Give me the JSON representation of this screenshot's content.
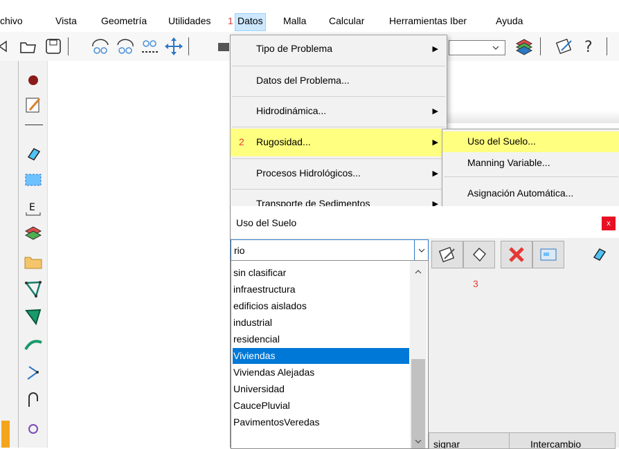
{
  "menubar": {
    "items": [
      {
        "label": "chivo"
      },
      {
        "label": "Vista"
      },
      {
        "label": "Geometría"
      },
      {
        "label": "Utilidades"
      },
      {
        "label": "Datos",
        "marker": "1"
      },
      {
        "label": "Malla"
      },
      {
        "label": "Calcular"
      },
      {
        "label": "Herramientas Iber"
      },
      {
        "label": "Ayuda"
      }
    ]
  },
  "datos_menu": {
    "items": [
      {
        "label": "Tipo de Problema",
        "submenu": true
      },
      {
        "label": "Datos del Problema...",
        "submenu": false
      },
      {
        "label": "Hidrodinámica...",
        "submenu": true
      },
      {
        "label": "Rugosidad...",
        "submenu": true,
        "marker": "2"
      },
      {
        "label": "Procesos Hidrológicos...",
        "submenu": true
      },
      {
        "label": "Transporte de Sedimentos",
        "submenu": true
      }
    ]
  },
  "rugosidad_submenu": {
    "items": [
      {
        "label": "Uso del Suelo..."
      },
      {
        "label": "Manning Variable..."
      },
      {
        "label": "Asignación Automática..."
      }
    ]
  },
  "dialog": {
    "title": "Uso del Suelo",
    "close_label": "x",
    "combo_value": "rio",
    "marker3": "3",
    "list_items": [
      "sin clasificar",
      "infraestructura",
      "edificios aislados",
      "industrial",
      "residencial",
      "Viviendas",
      "Viviendas Alejadas",
      "Universidad",
      "CaucePluvial",
      "PavimentosVeredas"
    ],
    "selected_item": "Viviendas",
    "bottom_buttons": {
      "assign": "signar",
      "exchange": "Intercambio"
    }
  },
  "colors": {
    "highlight": "#ffff80",
    "selection": "#0078d7",
    "marker": "#e53935",
    "close": "#e81123"
  }
}
